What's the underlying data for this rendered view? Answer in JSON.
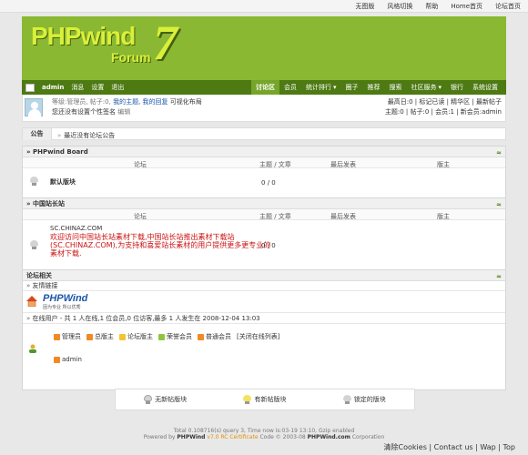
{
  "topbar": {
    "links": [
      "无图版",
      "风格切换",
      "帮助",
      "Home首页",
      "论坛首页"
    ]
  },
  "logo": {
    "text": "PHPwind",
    "forum": "Forum",
    "seven": "7"
  },
  "nav": {
    "username": "admin",
    "links": [
      "消息",
      "设置",
      "退出"
    ],
    "menu": [
      "讨论区",
      "会员",
      "统计排行",
      "圈子",
      "推荐",
      "搜索",
      "社区服务",
      "银行",
      "系统设置"
    ],
    "menu_dropdowns": [
      false,
      false,
      true,
      false,
      false,
      false,
      true,
      false,
      false
    ]
  },
  "userinfo": {
    "line1_prefix": "等级:管理员, 帖子:0,",
    "line1_links": "我的主题, 我的回复",
    "line1_layout": "可视化布局",
    "line2": "您还没有设置个性签名",
    "line2_edit": "编辑",
    "right1": "最高日:0 | 标记已读 | 精华区 | 最新帖子",
    "right2": "主题:0 | 帖子:0 | 会员:1 | 新会员:admin"
  },
  "notice": {
    "label": "公告",
    "text": "最近没有论坛公告"
  },
  "common_cols": {
    "forum": "论坛",
    "topics": "主题 / 文章",
    "last": "最后发表",
    "mod": "版主"
  },
  "cat1": {
    "title": "» PHPwind Board",
    "forum": "默认版块",
    "count": "0",
    "count2": "0"
  },
  "cat2": {
    "title": "» 中国站长站",
    "ad_url": "SC.CHINAZ.COM",
    "ad_text": "欢迎访问中国站长站素材下载,中国站长站推出素材下载站(SC.CHINAZ.COM),为支持和喜爱站长素材的用户提供更多更专业的素材下载.",
    "count": "0",
    "count2": "0"
  },
  "cat3": {
    "title": "论坛相关",
    "links_label": "友情链接",
    "partner_logo": "PHPWind",
    "partner_tagline": "因为专业 所以优秀",
    "online": "在线用户 - 共 1 人在线,1 位会员,0 位访客,最多 1 人发生在 2008-12-04 13:03",
    "legend": [
      "管理员",
      "总版主",
      "论坛版主",
      "荣誉会员",
      "普通会员"
    ],
    "legend_colors": [
      "#f08a24",
      "#f08a24",
      "#f4c430",
      "#8cc63f",
      "#f08a24"
    ],
    "close_list": "[关闭在线列表]",
    "online_user": "admin"
  },
  "bottom": {
    "items": [
      "无新帖版块",
      "有新帖版块",
      "锁定的版块"
    ]
  },
  "footer": {
    "line1": "Total 0.108716(s) query 3, Time now is:03-19 13:10, Gzip enabled",
    "line2_prefix": "Powered by",
    "brand": "PHPWind",
    "version": "v7.0 RC Certificate",
    "line2_mid": "Code © 2003-08",
    "brand2": "PHPWind.com",
    "line2_end": "Corporation",
    "links": "清除Cookies | Contact us | Wap | Top"
  }
}
